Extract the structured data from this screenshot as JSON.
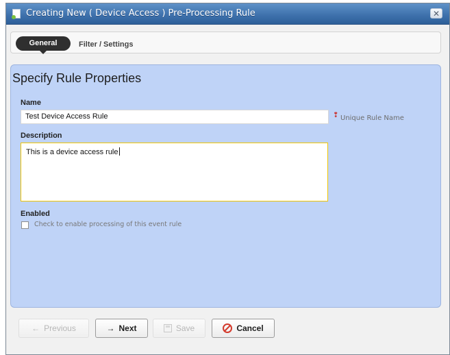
{
  "window": {
    "title": "Creating New ( Device Access ) Pre-Processing Rule",
    "close_label": "✕"
  },
  "tabs": [
    {
      "label": "General"
    },
    {
      "label": "Filter / Settings"
    }
  ],
  "form": {
    "heading": "Specify Rule Properties",
    "name_label": "Name",
    "name_value": "Test Device Access Rule",
    "name_hint": "Unique Rule Name",
    "description_label": "Description",
    "description_value": "This is a device access rule",
    "enabled_label": "Enabled",
    "enabled_hint": "Check to enable processing of this event rule"
  },
  "footer": {
    "previous_label": "Previous",
    "next_label": "Next",
    "save_label": "Save",
    "cancel_label": "Cancel"
  },
  "icons": {
    "title_icon": "document-icon",
    "required_icon": "required-icon",
    "previous_icon": "arrow-left-icon",
    "next_icon": "arrow-right-icon",
    "save_icon": "save-icon",
    "cancel_icon": "cancel-icon"
  },
  "colors": {
    "title_bar": "#3f72ad",
    "panel_background": "#bfd3f7",
    "focus_border": "#f0c500",
    "cancel_accent": "#d33a2c"
  }
}
